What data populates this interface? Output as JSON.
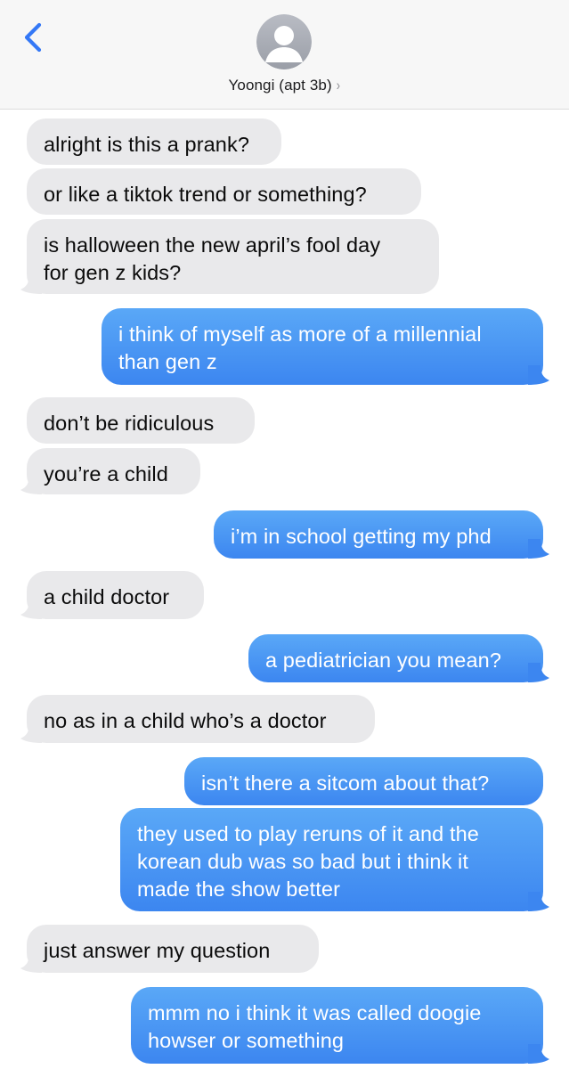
{
  "header": {
    "contact_name": "Yoongi (apt 3b)",
    "chevron": "›",
    "back_icon": "chevron-left-icon",
    "avatar_icon": "person-silhouette-icon",
    "accent_color": "#3478f6"
  },
  "messages": [
    {
      "dir": "in",
      "text": "alright is this a prank?"
    },
    {
      "dir": "in",
      "text": "or like a tiktok trend or something?"
    },
    {
      "dir": "in",
      "text": "is halloween the new april’s fool day\nfor gen z kids?"
    },
    {
      "dir": "out",
      "text": "i think of myself as more of a millennial\nthan gen z"
    },
    {
      "dir": "in",
      "text": "don’t be ridiculous"
    },
    {
      "dir": "in",
      "text": "you’re a child"
    },
    {
      "dir": "out",
      "text": "i’m in school getting my phd"
    },
    {
      "dir": "in",
      "text": "a child doctor"
    },
    {
      "dir": "out",
      "text": "a pediatrician you mean?"
    },
    {
      "dir": "in",
      "text": "no as in a child who’s a doctor"
    },
    {
      "dir": "out",
      "text": "isn’t there a sitcom about that?"
    },
    {
      "dir": "out",
      "text": "they used to play reruns of it and the\nkorean dub was so bad but i think it\nmade the show better"
    },
    {
      "dir": "in",
      "text": "just answer my question"
    },
    {
      "dir": "out",
      "text": "mmm no i think it was called doogie\nhowser or something"
    }
  ],
  "colors": {
    "incoming_bubble": "#e9e9eb",
    "outgoing_bubble": "#3c86f0",
    "header_bg": "#f7f7f7"
  }
}
